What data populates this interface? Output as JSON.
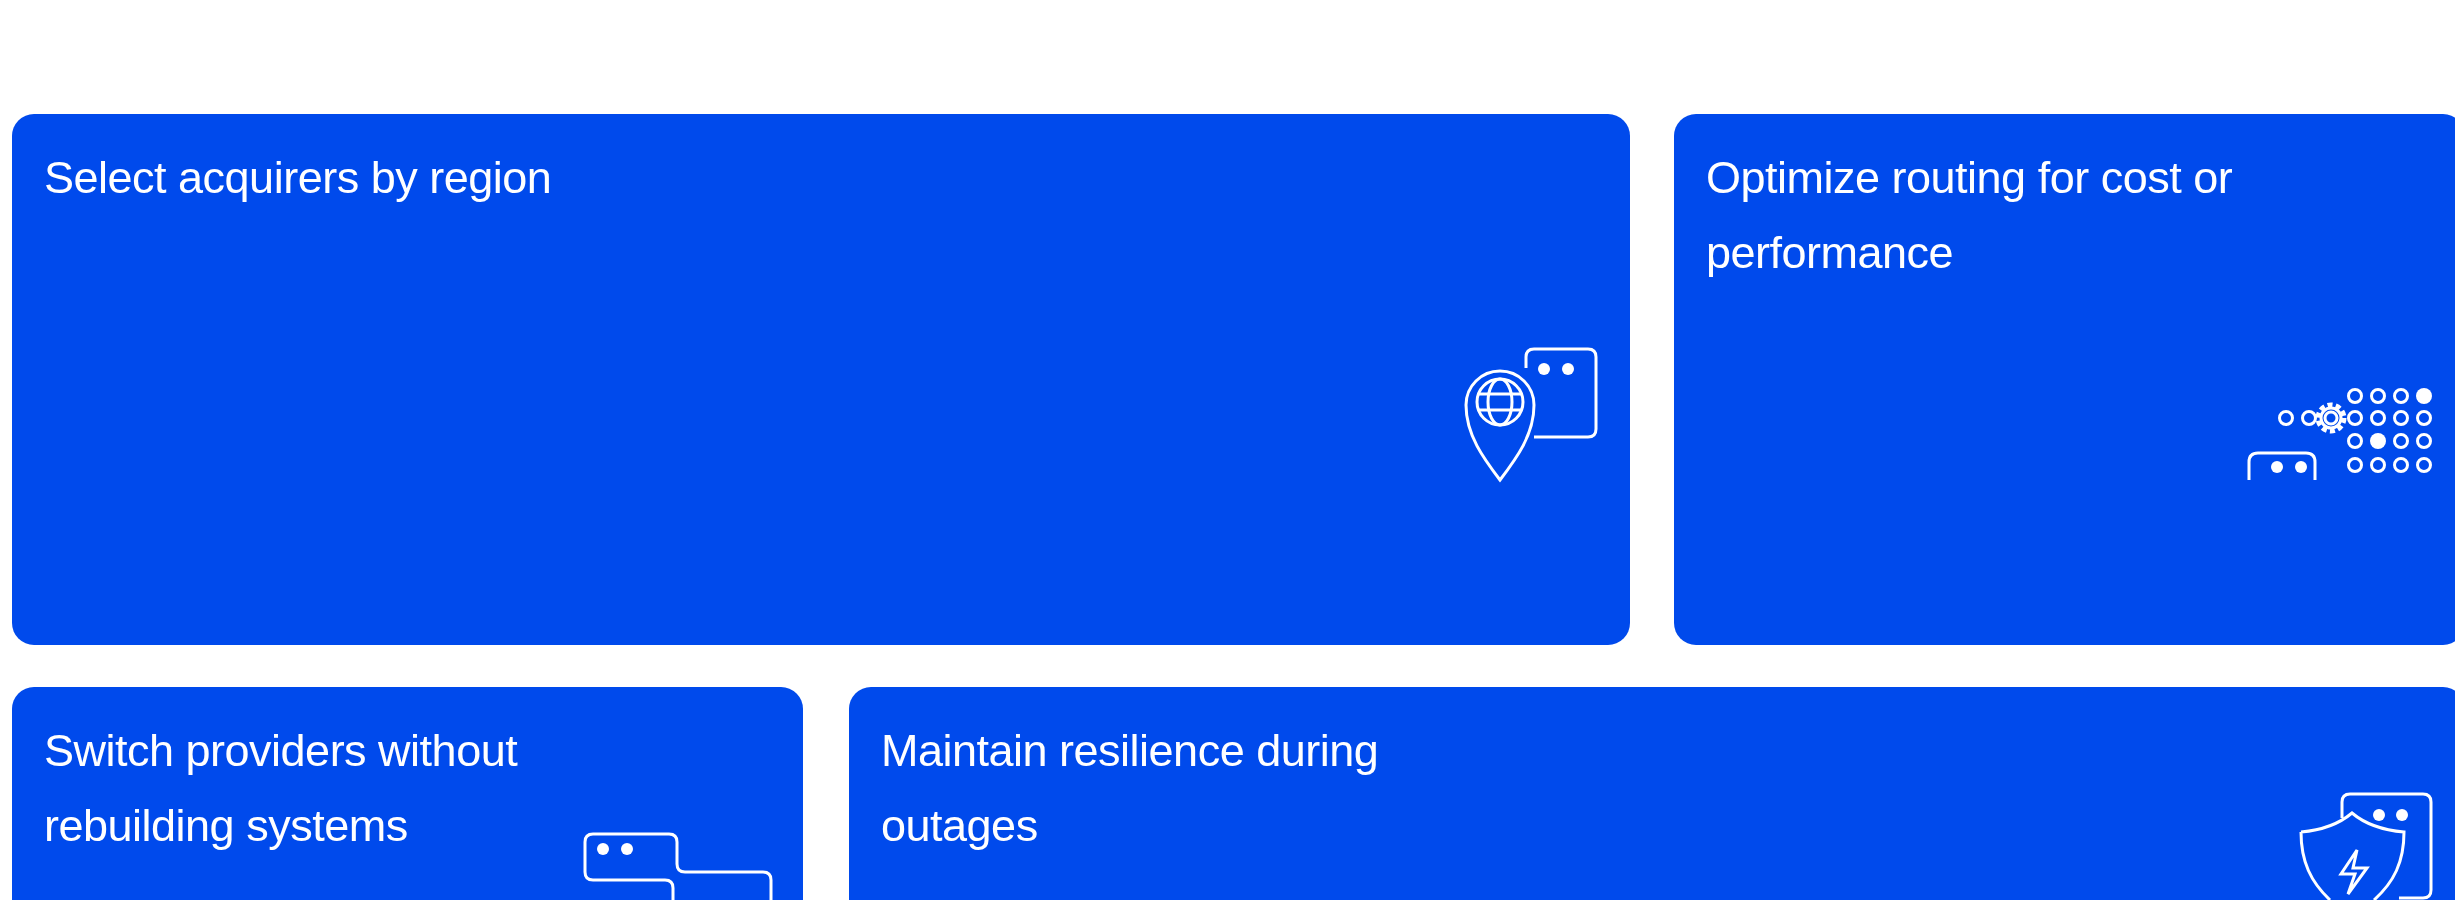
{
  "cards": [
    {
      "title": "Select acquirers by region"
    },
    {
      "title": "Optimize routing for cost or performance"
    },
    {
      "title": "Switch providers without rebuilding systems"
    },
    {
      "title": "Maintain resilience during outages"
    }
  ]
}
